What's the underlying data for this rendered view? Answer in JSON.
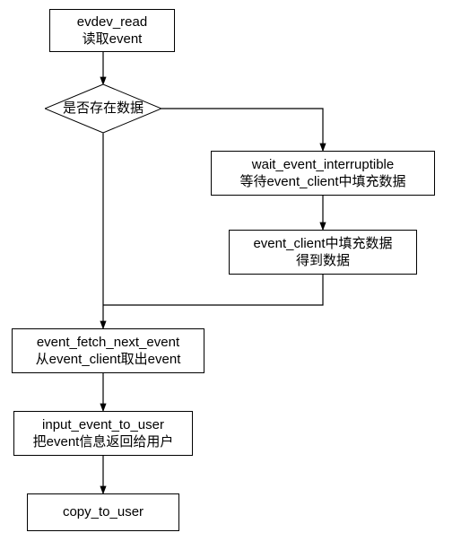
{
  "nodes": {
    "start": {
      "line1": "evdev_read",
      "line2": "读取event"
    },
    "decision": {
      "label": "是否存在数据"
    },
    "wait": {
      "line1": "wait_event_interruptible",
      "line2": "等待event_client中填充数据"
    },
    "filled": {
      "line1": "event_client中填充数据",
      "line2": "得到数据"
    },
    "fetch": {
      "line1": "event_fetch_next_event",
      "line2": "从event_client取出event"
    },
    "touser": {
      "line1": "input_event_to_user",
      "line2": "把event信息返回给用户"
    },
    "copy": {
      "line1": "copy_to_user"
    }
  },
  "chart_data": {
    "type": "flowchart",
    "nodes": [
      {
        "id": "start",
        "shape": "rect",
        "text": "evdev_read\n读取event"
      },
      {
        "id": "decision",
        "shape": "diamond",
        "text": "是否存在数据"
      },
      {
        "id": "wait",
        "shape": "rect",
        "text": "wait_event_interruptible\n等待event_client中填充数据"
      },
      {
        "id": "filled",
        "shape": "rect",
        "text": "event_client中填充数据\n得到数据"
      },
      {
        "id": "fetch",
        "shape": "rect",
        "text": "event_fetch_next_event\n从event_client取出event"
      },
      {
        "id": "touser",
        "shape": "rect",
        "text": "input_event_to_user\n把event信息返回给用户"
      },
      {
        "id": "copy",
        "shape": "rect",
        "text": "copy_to_user"
      }
    ],
    "edges": [
      {
        "from": "start",
        "to": "decision"
      },
      {
        "from": "decision",
        "to": "wait"
      },
      {
        "from": "wait",
        "to": "filled"
      },
      {
        "from": "decision",
        "to": "fetch"
      },
      {
        "from": "filled",
        "to": "fetch"
      },
      {
        "from": "fetch",
        "to": "touser"
      },
      {
        "from": "touser",
        "to": "copy"
      }
    ]
  }
}
